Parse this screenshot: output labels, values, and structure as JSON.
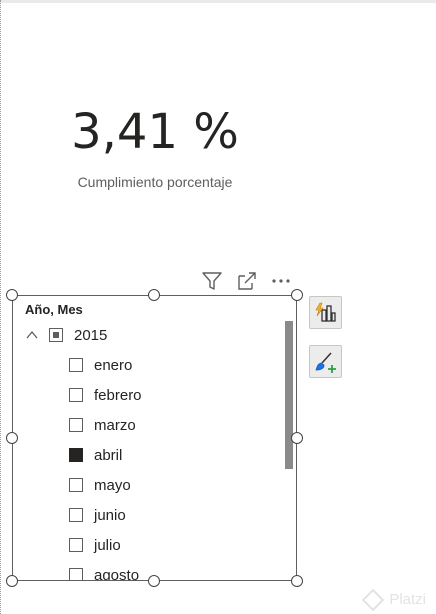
{
  "kpi": {
    "value": "3,41 %",
    "label": "Cumplimiento porcentaje"
  },
  "visual_header": {
    "icons": [
      "filter-icon",
      "focus-mode-icon",
      "more-options-icon"
    ],
    "more_label": "···"
  },
  "slicer": {
    "title": "Año, Mes",
    "year": {
      "label": "2015",
      "state": "partial",
      "expanded": true
    },
    "months": [
      {
        "label": "enero",
        "checked": false
      },
      {
        "label": "febrero",
        "checked": false
      },
      {
        "label": "marzo",
        "checked": false
      },
      {
        "label": "abril",
        "checked": true
      },
      {
        "label": "mayo",
        "checked": false
      },
      {
        "label": "junio",
        "checked": false
      },
      {
        "label": "julio",
        "checked": false
      },
      {
        "label": "agosto",
        "checked": false
      }
    ]
  },
  "side_buttons": [
    "build-visual-icon",
    "format-visual-icon"
  ],
  "watermark": {
    "text": "Platzi"
  },
  "colors": {
    "checked": "#252423",
    "scrollbar": "#8a8a8a",
    "accent_orange": "#f2b233",
    "accent_green": "#2f9e44",
    "accent_blue": "#1a73e8"
  }
}
